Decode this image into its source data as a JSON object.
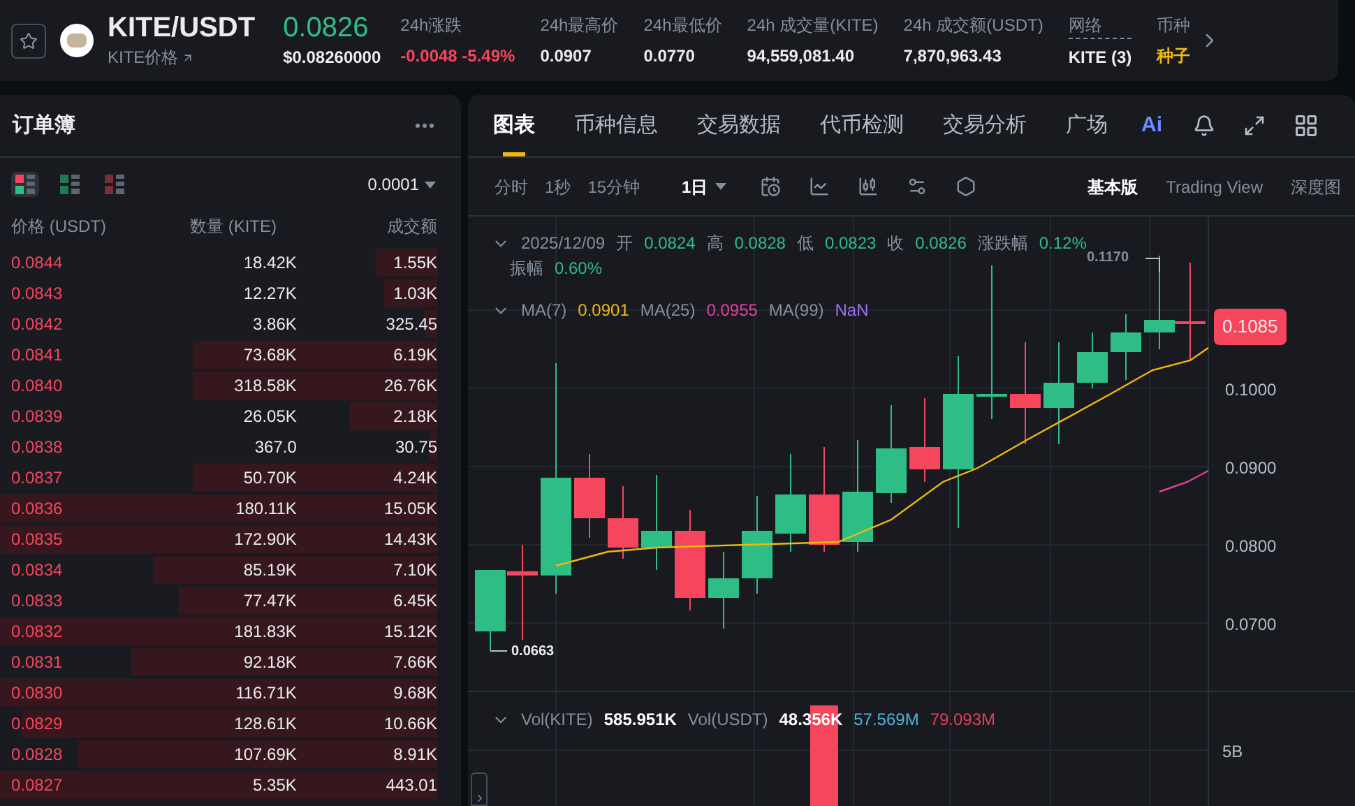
{
  "ticker": {
    "pair": "KITE/USDT",
    "subtitle": "KITE价格",
    "price": "0.0826",
    "price_usd": "$0.08260000",
    "stats": [
      {
        "label": "24h涨跌",
        "value": "-0.0048 -5.49%",
        "kind": "down"
      },
      {
        "label": "24h最高价",
        "value": "0.0907",
        "kind": "plain"
      },
      {
        "label": "24h最低价",
        "value": "0.0770",
        "kind": "plain"
      },
      {
        "label": "24h 成交量(KITE)",
        "value": "94,559,081.40",
        "kind": "plain"
      },
      {
        "label": "24h 成交额(USDT)",
        "value": "7,870,963.43",
        "kind": "plain"
      },
      {
        "label": "网络",
        "value": "KITE (3)",
        "kind": "link"
      },
      {
        "label": "币种",
        "value": "种子",
        "kind": "tag"
      }
    ]
  },
  "order_book": {
    "title": "订单簿",
    "views": [
      {
        "selected": true
      },
      {
        "selected": false
      },
      {
        "selected": false
      }
    ],
    "precision": "0.0001",
    "columns": [
      "价格 (USDT)",
      "数量 (KITE)",
      "成交额"
    ],
    "rows": [
      {
        "price": "0.0844",
        "amount": "18.42K",
        "total": "1.55K",
        "level": 0.14
      },
      {
        "price": "0.0843",
        "amount": "12.27K",
        "total": "1.03K",
        "level": 0.12
      },
      {
        "price": "0.0842",
        "amount": "3.86K",
        "total": "325.45",
        "level": 0.03
      },
      {
        "price": "0.0841",
        "amount": "73.68K",
        "total": "6.19K",
        "level": 0.56
      },
      {
        "price": "0.0840",
        "amount": "318.58K",
        "total": "26.76K",
        "level": 0.56
      },
      {
        "price": "0.0839",
        "amount": "26.05K",
        "total": "2.18K",
        "level": 0.2
      },
      {
        "price": "0.0838",
        "amount": "367.0",
        "total": "30.75",
        "level": 0.02
      },
      {
        "price": "0.0837",
        "amount": "50.70K",
        "total": "4.24K",
        "level": 0.56
      },
      {
        "price": "0.0836",
        "amount": "180.11K",
        "total": "15.05K",
        "level": 1
      },
      {
        "price": "0.0835",
        "amount": "172.90K",
        "total": "14.43K",
        "level": 1
      },
      {
        "price": "0.0834",
        "amount": "85.19K",
        "total": "7.10K",
        "level": 0.65
      },
      {
        "price": "0.0833",
        "amount": "77.47K",
        "total": "6.45K",
        "level": 0.59
      },
      {
        "price": "0.0832",
        "amount": "181.83K",
        "total": "15.12K",
        "level": 1
      },
      {
        "price": "0.0831",
        "amount": "92.18K",
        "total": "7.66K",
        "level": 0.7
      },
      {
        "price": "0.0830",
        "amount": "116.71K",
        "total": "9.68K",
        "level": 1
      },
      {
        "price": "0.0829",
        "amount": "128.61K",
        "total": "10.66K",
        "level": 0.95
      },
      {
        "price": "0.0828",
        "amount": "107.69K",
        "total": "8.91K",
        "level": 0.82
      },
      {
        "price": "0.0827",
        "amount": "5.35K",
        "total": "443.01",
        "level": 1
      }
    ]
  },
  "chart_panel": {
    "tabs": [
      {
        "label": "图表",
        "selected": true
      },
      {
        "label": "币种信息",
        "selected": false
      },
      {
        "label": "交易数据",
        "selected": false
      },
      {
        "label": "代币检测",
        "selected": false
      },
      {
        "label": "交易分析",
        "selected": false
      },
      {
        "label": "广场",
        "selected": false
      }
    ],
    "ai_label": "Ai",
    "intervals": [
      {
        "label": "分时",
        "selected": false
      },
      {
        "label": "1秒",
        "selected": false
      },
      {
        "label": "15分钟",
        "selected": false
      },
      {
        "label": "1日",
        "selected": true
      }
    ],
    "modes": [
      {
        "label": "基本版",
        "selected": true
      },
      {
        "label": "Trading View",
        "selected": false
      },
      {
        "label": "深度图",
        "selected": false
      }
    ],
    "ohlc": {
      "date": "2025/12/09",
      "fields": [
        {
          "label": "开",
          "value": "0.0824"
        },
        {
          "label": "高",
          "value": "0.0828"
        },
        {
          "label": "低",
          "value": "0.0823"
        },
        {
          "label": "收",
          "value": "0.0826"
        },
        {
          "label": "涨跌幅",
          "value": "0.12%"
        },
        {
          "label": "振幅",
          "value": "0.60%"
        }
      ]
    },
    "ma": [
      {
        "name": "MA(7)",
        "value": "0.0901",
        "color": "#f0b90b"
      },
      {
        "name": "MA(25)",
        "value": "0.0955",
        "color": "#e040a0"
      },
      {
        "name": "MA(99)",
        "value": "NaN",
        "color": "#a070f0"
      }
    ],
    "high_marker": "0.1170",
    "low_marker": "0.0663",
    "last_price": "0.1085",
    "y_axis": [
      "0.1000",
      "0.0900",
      "0.0800",
      "0.0700"
    ],
    "volume": {
      "items": [
        {
          "name": "Vol(KITE)",
          "value": "585.951K"
        },
        {
          "name": "Vol(USDT)",
          "value": "48.356K"
        }
      ],
      "extra": [
        {
          "value": "57.569M",
          "color": "#4fb3d9"
        },
        {
          "value": "79.093M",
          "color": "#e0405a"
        }
      ],
      "axis": "5B"
    }
  }
}
